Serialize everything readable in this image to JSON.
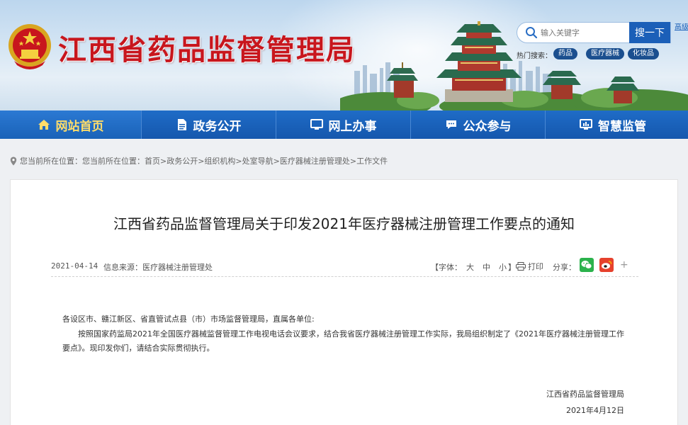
{
  "header": {
    "site_title": "江西省药品监督管理局",
    "search": {
      "placeholder": "输入关键字",
      "button_label": "搜一下",
      "advanced_link": "高级搜索"
    },
    "hot_label": "热门搜索：",
    "hot_tags": [
      "药品",
      "医疗器械",
      "化妆品"
    ],
    "title_color": "#c8161d",
    "brand_blue": "#1b5fb8"
  },
  "nav": {
    "items": [
      {
        "label": "网站首页",
        "icon": "home-icon",
        "active": true
      },
      {
        "label": "政务公开",
        "icon": "document-icon"
      },
      {
        "label": "网上办事",
        "icon": "monitor-icon"
      },
      {
        "label": "公众参与",
        "icon": "chat-icon"
      },
      {
        "label": "智慧监管",
        "icon": "dashboard-icon"
      }
    ]
  },
  "breadcrumb": {
    "text": "您当前所在位置：您当前所在位置：首页>政务公开>组织机构>处室导航>医疗器械注册管理处>工作文件"
  },
  "article": {
    "title": "江西省药品监督管理局关于印发2021年医疗器械注册管理工作要点的通知",
    "date": "2021-04-14",
    "source": "信息来源：医疗器械注册管理处",
    "font_label": "【字体：",
    "font_sizes": [
      "大",
      "中",
      "小"
    ],
    "font_close": "】",
    "print_label": "打印",
    "share_label": "分享：",
    "share_more": "+",
    "salutation": "各设区市、赣江新区、省直管试点县（市）市场监督管理局，直属各单位:",
    "paragraph": "按照国家药监局2021年全国医疗器械监督管理工作电视电话会议要求，结合我省医疗器械注册管理工作实际，我局组织制定了《2021年医疗器械注册管理工作要点》。现印发你们，请结合实际贯彻执行。",
    "signature_org": "江西省药品监督管理局",
    "signature_date": "2021年4月12日"
  }
}
